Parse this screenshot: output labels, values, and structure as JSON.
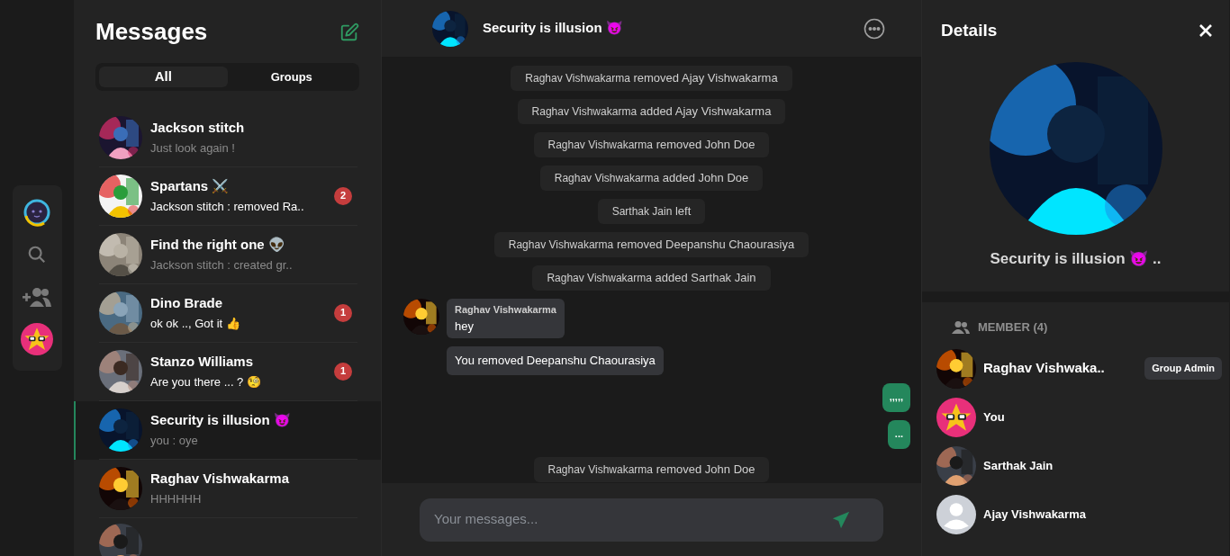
{
  "rail": {
    "items": [
      {
        "kind": "logo",
        "selected": false
      },
      {
        "kind": "search",
        "selected": false
      },
      {
        "kind": "add-user",
        "selected": false
      },
      {
        "kind": "profile",
        "selected": false
      }
    ]
  },
  "sidebar": {
    "title": "Messages",
    "tabs": [
      {
        "label": "All",
        "selected": true
      },
      {
        "label": "Groups",
        "selected": false
      }
    ],
    "chats": [
      {
        "name": "Jackson stitch",
        "preview": "Just look again !",
        "unread": false,
        "selected": false
      },
      {
        "name": "Spartans ⚔️",
        "preview": "Jackson stitch : removed Ra..",
        "unread": true,
        "badge": "2",
        "selected": false
      },
      {
        "name": "Find the right one 👽",
        "preview": "Jackson stitch : created gr..",
        "unread": false,
        "selected": false
      },
      {
        "name": "Dino Brade",
        "preview": "ok ok .., Got it 👍",
        "unread": true,
        "badge": "1",
        "selected": false
      },
      {
        "name": "Stanzo Williams",
        "preview": "Are you there ... ? 🧐",
        "unread": true,
        "badge": "1",
        "selected": false
      },
      {
        "name": "Security is illusion 😈",
        "preview": "you : oye",
        "unread": false,
        "selected": true
      },
      {
        "name": "Raghav Vishwakarma",
        "preview": "HHHHHH",
        "unread": false,
        "selected": false
      }
    ]
  },
  "chat": {
    "title": "Security is illusion 😈",
    "input": {
      "placeholder": "Your messages..."
    },
    "messages": [
      {
        "kind": "system",
        "actor": "Raghav Vishwakarma",
        "action": "removed Ajay Vishwakarma"
      },
      {
        "kind": "system",
        "actor": "Raghav Vishwakarma",
        "action": "added Ajay Vishwakarma"
      },
      {
        "kind": "system",
        "actor": "Raghav Vishwakarma",
        "action": "removed John Doe"
      },
      {
        "kind": "system",
        "actor": "Raghav Vishwakarma",
        "action": "added John Doe"
      },
      {
        "kind": "system",
        "actor": "Sarthak Jain",
        "action": "left"
      },
      {
        "kind": "system",
        "actor": "Raghav Vishwakarma",
        "action": "removed Deepanshu Chaourasiya"
      },
      {
        "kind": "system",
        "actor": "Raghav Vishwakarma",
        "action": "added Sarthak Jain"
      },
      {
        "kind": "incoming",
        "sender": "Raghav Vishwakarma",
        "text": "hey"
      },
      {
        "kind": "incoming-cont",
        "text": "You removed Deepanshu Chaourasiya"
      },
      {
        "kind": "outgoing",
        "text": ",,,,,"
      },
      {
        "kind": "outgoing",
        "text": "..."
      },
      {
        "kind": "system",
        "actor": "Raghav Vishwakarma",
        "action": "removed John Doe"
      }
    ]
  },
  "details": {
    "title": "Details",
    "name": "Security is illusion 😈 ..",
    "members_label": "MEMBER (4)",
    "members": [
      {
        "name": "Raghav Vishwaka..",
        "badge": "Group Admin",
        "admin": true
      },
      {
        "name": "You",
        "kind": "star",
        "admin": false
      },
      {
        "name": "Sarthak Jain",
        "admin": false
      },
      {
        "name": "Ajay Vishwakarma",
        "kind": "default",
        "admin": false
      }
    ]
  }
}
